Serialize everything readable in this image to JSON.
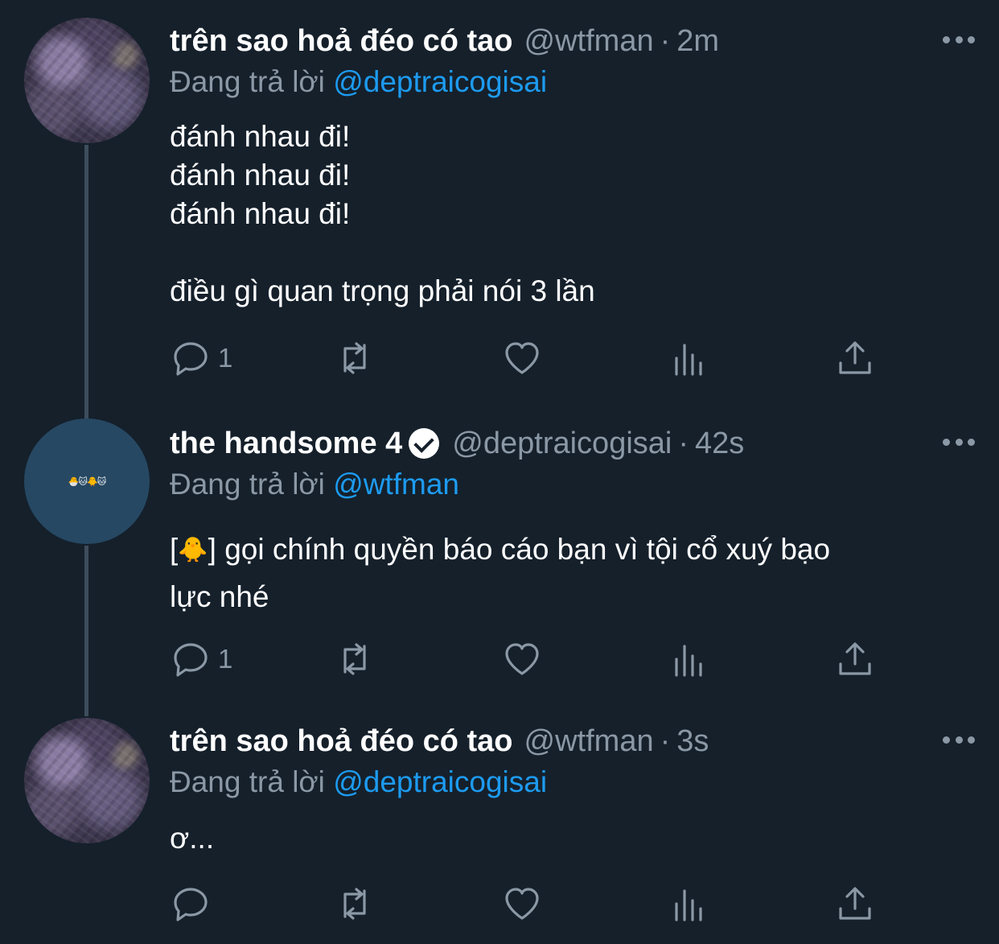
{
  "tweets": [
    {
      "name": "trên sao hoả đéo có tao",
      "handle": "@wtfman",
      "separator": "·",
      "time": "2m",
      "replying_prefix": "Đang trả lời",
      "replying_to": "@deptraicogisai",
      "body": "đánh nhau đi!\nđánh nhau đi!\nđánh nhau đi!\n\nđiều gì quan trọng phải nói 3 lần",
      "reply_count": "1",
      "avatar": "galaxy-avatar"
    },
    {
      "name": "the handsome 4",
      "verified": true,
      "handle": "@deptraicogisai",
      "separator": "·",
      "time": "42s",
      "replying_prefix": "Đang trả lời",
      "replying_to": "@wtfman",
      "body_open": "[",
      "body_emoji": "🐥",
      "body_rest": "] gọi chính quyền báo cáo bạn vì tội cổ xuý bạo\nlực nhé",
      "reply_count": "1",
      "avatar": "blue-avatar",
      "avatar_emoji": "🐣🐱🐥🐱"
    },
    {
      "name": "trên sao hoả đéo có tao",
      "handle": "@wtfman",
      "separator": "·",
      "time": "3s",
      "replying_prefix": "Đang trả lời",
      "replying_to": "@deptraicogisai",
      "body": "ơ...",
      "reply_count": "",
      "avatar": "galaxy-avatar"
    }
  ],
  "icons": [
    "reply-icon",
    "retweet-icon",
    "like-icon",
    "analytics-icon",
    "share-icon",
    "more-icon",
    "verified-icon"
  ],
  "colors": {
    "background": "#15202b",
    "mention": "#1d9bf0",
    "muted": "#8b98a5",
    "thread_line": "#3e4d5c"
  }
}
